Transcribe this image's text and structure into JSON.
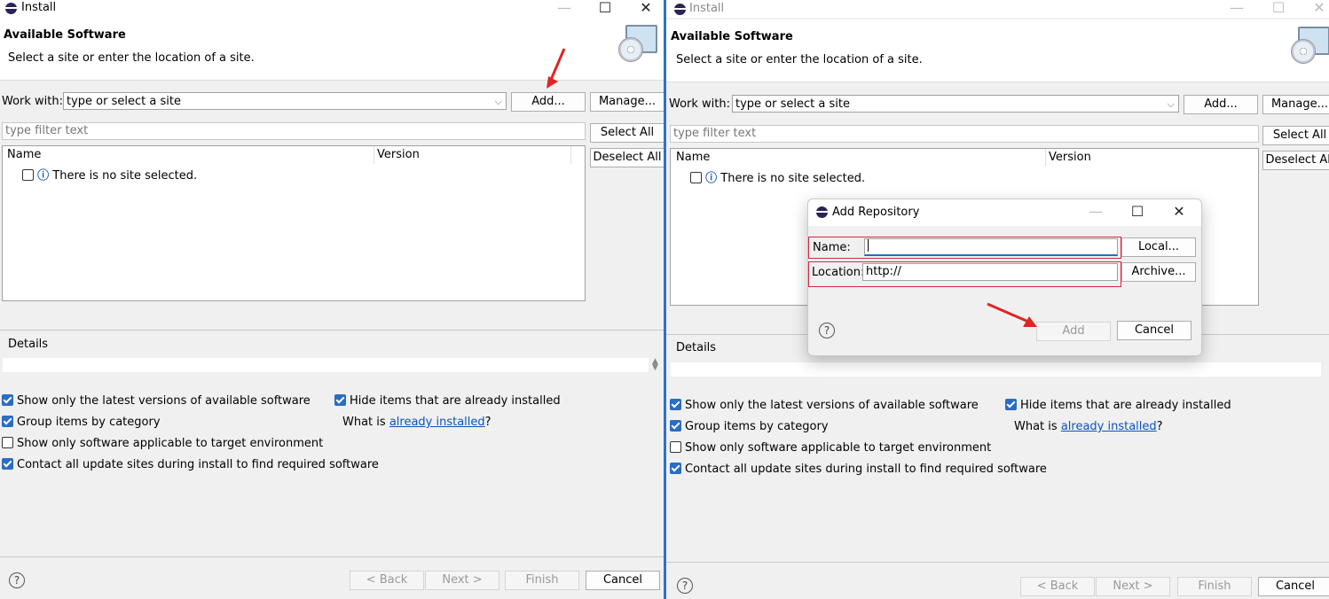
{
  "install_window": {
    "title": "Install",
    "header_title": "Available Software",
    "header_subtitle": "Select a site or enter the location of a site.",
    "work_with_label": "Work with:",
    "work_with_value": "type or select a site",
    "add_button": "Add...",
    "manage_button": "Manage...",
    "filter_placeholder": "type filter text",
    "select_all_button": "Select All",
    "deselect_all_button": "Deselect All",
    "columns": [
      "Name",
      "Version"
    ],
    "tree_message": "There is no site selected.",
    "details_label": "Details",
    "options": [
      {
        "label": "Show only the latest versions of available software",
        "checked": true
      },
      {
        "label": "Group items by category",
        "checked": true
      },
      {
        "label": "Show only software applicable to target environment",
        "checked": false
      },
      {
        "label": "Contact all update sites during install to find required software",
        "checked": true
      }
    ],
    "hide_installed_label": "Hide items that are already installed",
    "what_is_prefix": "What is ",
    "already_installed_link": "already installed",
    "what_is_suffix": "?",
    "help_glyph": "?",
    "back_button": "< Back",
    "next_button": "Next >",
    "finish_button": "Finish",
    "cancel_button": "Cancel"
  },
  "add_repository_dialog": {
    "title": "Add Repository",
    "name_label": "Name:",
    "name_value": "",
    "location_label": "Location:",
    "location_value": "http://",
    "local_button": "Local...",
    "archive_button": "Archive...",
    "add_button": "Add",
    "cancel_button": "Cancel",
    "help_glyph": "?"
  },
  "window_controls": {
    "minimize": "—",
    "maximize": "☐",
    "close": "✕"
  },
  "colors": {
    "accent": "#2b6cc4",
    "annotation_red": "#e02424",
    "link": "#0a53be"
  }
}
